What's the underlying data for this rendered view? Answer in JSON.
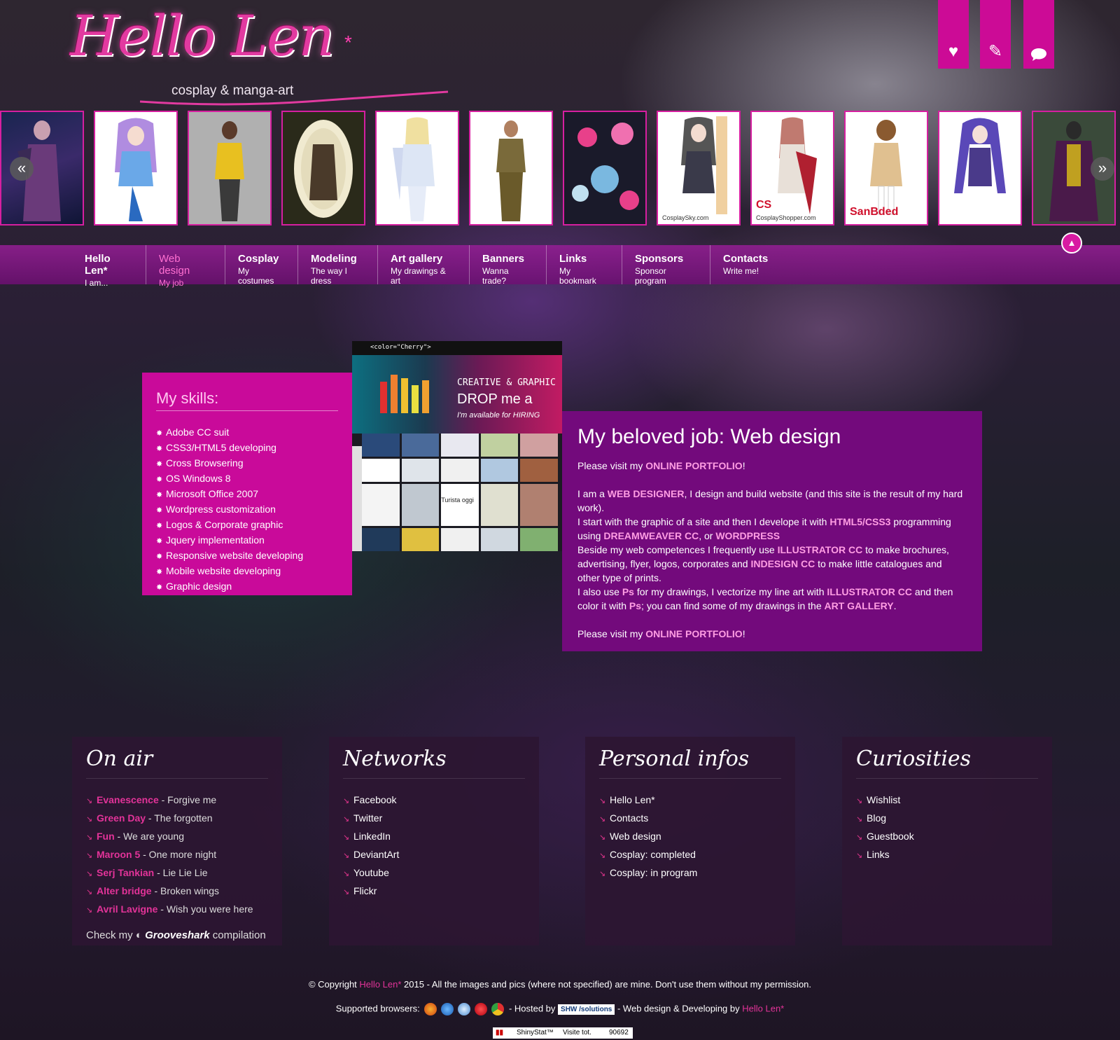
{
  "header": {
    "logo_title": "Hello Len",
    "logo_star": "*",
    "logo_subtitle": "cosplay & manga-art",
    "icons": [
      {
        "name": "heart-icon",
        "glyph": "♥"
      },
      {
        "name": "pencil-icon",
        "glyph": "✎"
      },
      {
        "name": "speech-bubble-icon",
        "glyph": "💬"
      }
    ]
  },
  "carousel": {
    "prev_label": "«",
    "next_label": "»",
    "thumbs": [
      {
        "caption": "",
        "logo": ""
      },
      {
        "caption": "",
        "logo": ""
      },
      {
        "caption": "",
        "logo": ""
      },
      {
        "caption": "",
        "logo": ""
      },
      {
        "caption": "",
        "logo": ""
      },
      {
        "caption": "",
        "logo": ""
      },
      {
        "caption": "",
        "logo": ""
      },
      {
        "caption": "CosplaySky.com",
        "logo": ""
      },
      {
        "caption": "CosplayShopper.com",
        "logo": "CS"
      },
      {
        "caption": "",
        "logo": "SanBded"
      },
      {
        "caption": "",
        "logo": ""
      },
      {
        "caption": "",
        "logo": ""
      }
    ]
  },
  "nav": {
    "up_label": "▲",
    "items": [
      {
        "title": "Hello Len*",
        "sub": "I am..."
      },
      {
        "title": "Web design",
        "sub": "My job"
      },
      {
        "title": "Cosplay",
        "sub": "My costumes"
      },
      {
        "title": "Modeling",
        "sub": "The way I dress"
      },
      {
        "title": "Art gallery",
        "sub": "My drawings & art"
      },
      {
        "title": "Banners",
        "sub": "Wanna trade?"
      },
      {
        "title": "Links",
        "sub": "My bookmark"
      },
      {
        "title": "Sponsors",
        "sub": "Sponsor program"
      },
      {
        "title": "Contacts",
        "sub": "Write me!"
      }
    ]
  },
  "skills": {
    "title": "My skills:",
    "items": [
      "Adobe CC suit",
      "CSS3/HTML5 developing",
      "Cross Browsering",
      "OS Windows 8",
      "Microsoft Office 2007",
      "Wordpress customization",
      "Logos & Corporate graphic",
      "Jquery implementation",
      "Responsive website developing",
      "Mobile website developing",
      "Graphic design"
    ]
  },
  "preview": {
    "brand": "<color=\"Cherry\">",
    "hero_line1": "CREATIVE & GRAPHIC",
    "hero_line2": "DROP me a",
    "hero_line3": "I'm available for HIRING",
    "tile_text": "Turista oggi"
  },
  "job": {
    "title": "My beloved job: Web design",
    "p1_pre": "Please visit my ",
    "p1_link": "ONLINE PORTFOLIO",
    "p1_post": "!",
    "p2_a": "I am a ",
    "p2_link": "WEB DESIGNER",
    "p2_b": ", I design and build website (and this site is the result of my hard work).",
    "p3_a": "I start with the graphic of a site and then I develope it with ",
    "p3_l1": "HTML5/CSS3",
    "p3_b": " programming using ",
    "p3_l2": "DREAMWEAVER CC",
    "p3_c": ", or ",
    "p3_l3": "WORDPRESS",
    "p4_a": "Beside my web competences I frequently use ",
    "p4_l1": "ILLUSTRATOR CC",
    "p4_b": " to make brochures, advertising, flyer, logos, corporates and ",
    "p4_l2": "INDESIGN CC",
    "p4_c": " to make little catalogues and other type of prints.",
    "p5_a": "I also use ",
    "p5_l1": "Ps",
    "p5_b": " for my drawings, I vectorize my line art with ",
    "p5_l2": "ILLUSTRATOR CC",
    "p5_c": " and then color it with ",
    "p5_l3": "Ps",
    "p5_d": "; you can find some of my drawings in the ",
    "p5_l4": "ART GALLERY",
    "p5_e": ".",
    "p6_pre": "Please visit my ",
    "p6_link": "ONLINE PORTFOLIO",
    "p6_post": "!"
  },
  "footer": {
    "onair": {
      "title": "On air",
      "items": [
        {
          "band": "Evanescence",
          "song": " - Forgive me"
        },
        {
          "band": "Green Day",
          "song": " - The forgotten"
        },
        {
          "band": "Fun",
          "song": " - We are young"
        },
        {
          "band": "Maroon 5",
          "song": " - One more night"
        },
        {
          "band": "Serj Tankian",
          "song": " - Lie Lie Lie"
        },
        {
          "band": "Alter bridge",
          "song": " - Broken wings"
        },
        {
          "band": "Avril Lavigne",
          "song": " - Wish you were here"
        }
      ],
      "check_pre": "Check my ",
      "check_brand": "Grooveshark",
      "check_post": " compilation"
    },
    "networks": {
      "title": "Networks",
      "items": [
        "Facebook",
        "Twitter",
        "LinkedIn",
        "DeviantArt",
        "Youtube",
        "Flickr"
      ]
    },
    "personal": {
      "title": "Personal infos",
      "items": [
        "Hello Len*",
        "Contacts",
        "Web design",
        "Cosplay: completed",
        "Cosplay: in program"
      ]
    },
    "curiosities": {
      "title": "Curiosities",
      "items": [
        "Wishlist",
        "Blog",
        "Guestbook",
        "Links"
      ]
    }
  },
  "copyright": {
    "pre": "© Copyright ",
    "brand": "Hello Len*",
    "post": " 2015 - All the images and pics (where not specified) are mine. Don't use them without my permission."
  },
  "browsers": {
    "label": "Supported browsers:",
    "hosted": " - Hosted by ",
    "host_brand": "SHW /solutions",
    "design": " - Web design & Developing by ",
    "design_brand": "Hello Len*"
  },
  "counter": {
    "logo": "ShinyStat™",
    "label": "Visite tot.",
    "value": "90692"
  },
  "colors": {
    "accent_pink": "#cc0b96",
    "nav_purple": "#8a1b8f",
    "job_purple": "#730a7c",
    "link_pink": "#ff9de3"
  }
}
